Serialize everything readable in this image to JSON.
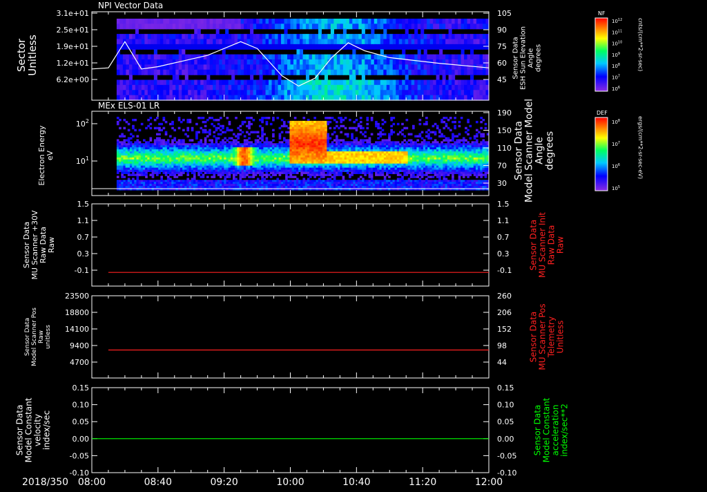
{
  "colors": {
    "background": "#000000",
    "axis": "#ffffff",
    "red": "#ff2020",
    "green": "#00ff00",
    "magnetometer_line": "#ffffff"
  },
  "time_axis": {
    "date_label": "2018/350",
    "ticks": [
      "08:00",
      "08:40",
      "09:20",
      "10:00",
      "10:40",
      "11:20",
      "12:00"
    ],
    "start": "08:00",
    "end": "12:00"
  },
  "chart_data": [
    {
      "type": "heatmap",
      "title": "NPI Vector Data",
      "ylabel_lines": [
        "Sector",
        "Unitless"
      ],
      "y_ticks": [
        "3.1e+01",
        "2.5e+01",
        "1.9e+01",
        "1.2e+01",
        "6.2e+00"
      ],
      "right_axis_ticks": [
        "105",
        "90",
        "75",
        "60",
        "45"
      ],
      "right_axis_label_lines": [
        "Sensor Data",
        "ESH Sun Elevation",
        "Angle",
        "degrees"
      ],
      "colorbar": {
        "label": "NF",
        "unit": "cnts/(cm**2-sr-sec)",
        "ticks": [
          "10^12",
          "10^11",
          "10^10",
          "10^9",
          "10^8",
          "10^7",
          "10^6"
        ]
      },
      "data_start": "08:15",
      "overlay_series": {
        "name": "ESH Sun Elevation",
        "x": [
          "08:00",
          "08:10",
          "08:20",
          "08:30",
          "08:40",
          "08:55",
          "09:10",
          "09:30",
          "09:40",
          "09:55",
          "10:05",
          "10:15",
          "10:25",
          "10:35",
          "10:45",
          "11:00",
          "11:30",
          "12:00"
        ],
        "y": [
          56,
          57,
          80,
          56,
          58,
          63,
          68,
          80,
          74,
          50,
          41,
          48,
          66,
          79,
          72,
          66,
          61,
          57
        ]
      }
    },
    {
      "type": "heatmap",
      "title": "MEx ELS-01 LR",
      "ylabel_lines": [
        "Electron Energy",
        "eV"
      ],
      "y_ticks": [
        "10^2",
        "10^1"
      ],
      "right_axis_ticks": [
        "190",
        "150",
        "110",
        "70",
        "30"
      ],
      "right_axis_label_lines": [
        "Sensor Data",
        "Model Scanner Model",
        "Angle",
        "degrees"
      ],
      "colorbar": {
        "label": "DEF",
        "unit": "ergs/(cm**2-sr-sec-eV)",
        "ticks": [
          "10^8",
          "10^7",
          "10^6",
          "10^5"
        ]
      },
      "data_start": "08:15",
      "features": [
        "enhanced flux 09:35-09:50",
        "strong flux 10:15-10:35"
      ]
    },
    {
      "type": "line",
      "left_ticks": [
        "1.5",
        "1.1",
        "0.7",
        "0.3",
        "-0.1"
      ],
      "right_ticks": [
        "1.5",
        "1.1",
        "0.7",
        "0.3",
        "-0.1"
      ],
      "left_label_lines": [
        "Sensor Data",
        "MU Scanner +30V",
        "Raw Data",
        "Raw"
      ],
      "right_label_lines": [
        "Sensor Data",
        "MU Scanner Init",
        "Raw Data",
        "Raw"
      ],
      "ylim": [
        -0.3,
        1.5
      ],
      "series": [
        {
          "x": [
            "08:10",
            "12:00"
          ],
          "y": [
            0.0,
            0.0
          ]
        }
      ]
    },
    {
      "type": "line",
      "left_ticks": [
        "23500",
        "18800",
        "14100",
        "9400",
        "4700"
      ],
      "right_ticks": [
        "260",
        "206",
        "152",
        "98",
        "44"
      ],
      "left_label_lines": [
        "Sensor Data",
        "Model Scanner Pos",
        "Raw",
        "unitless"
      ],
      "right_label_lines": [
        "Sensor Data",
        "MU Scanner Pos",
        "Telemetry",
        "Unitless"
      ],
      "ylim": [
        0,
        23500
      ],
      "series": [
        {
          "x": [
            "08:10",
            "12:00"
          ],
          "y": [
            8000,
            8000
          ]
        }
      ]
    },
    {
      "type": "line",
      "left_ticks": [
        "0.15",
        "0.10",
        "0.05",
        "0.00",
        "-0.05",
        "-0.10"
      ],
      "right_ticks": [
        "0.15",
        "0.10",
        "0.05",
        "0.00",
        "-0.05",
        "-0.10"
      ],
      "left_label_lines": [
        "Sensor Data",
        "Model Constant",
        "velocity",
        "index/sec"
      ],
      "right_label_lines": [
        "Sensor Data",
        "Model Constant",
        "acceleration",
        "index/sec**2"
      ],
      "ylim": [
        -0.1,
        0.15
      ],
      "series": [
        {
          "x": [
            "08:00",
            "12:00"
          ],
          "y": [
            0.0,
            0.0
          ]
        }
      ]
    }
  ]
}
